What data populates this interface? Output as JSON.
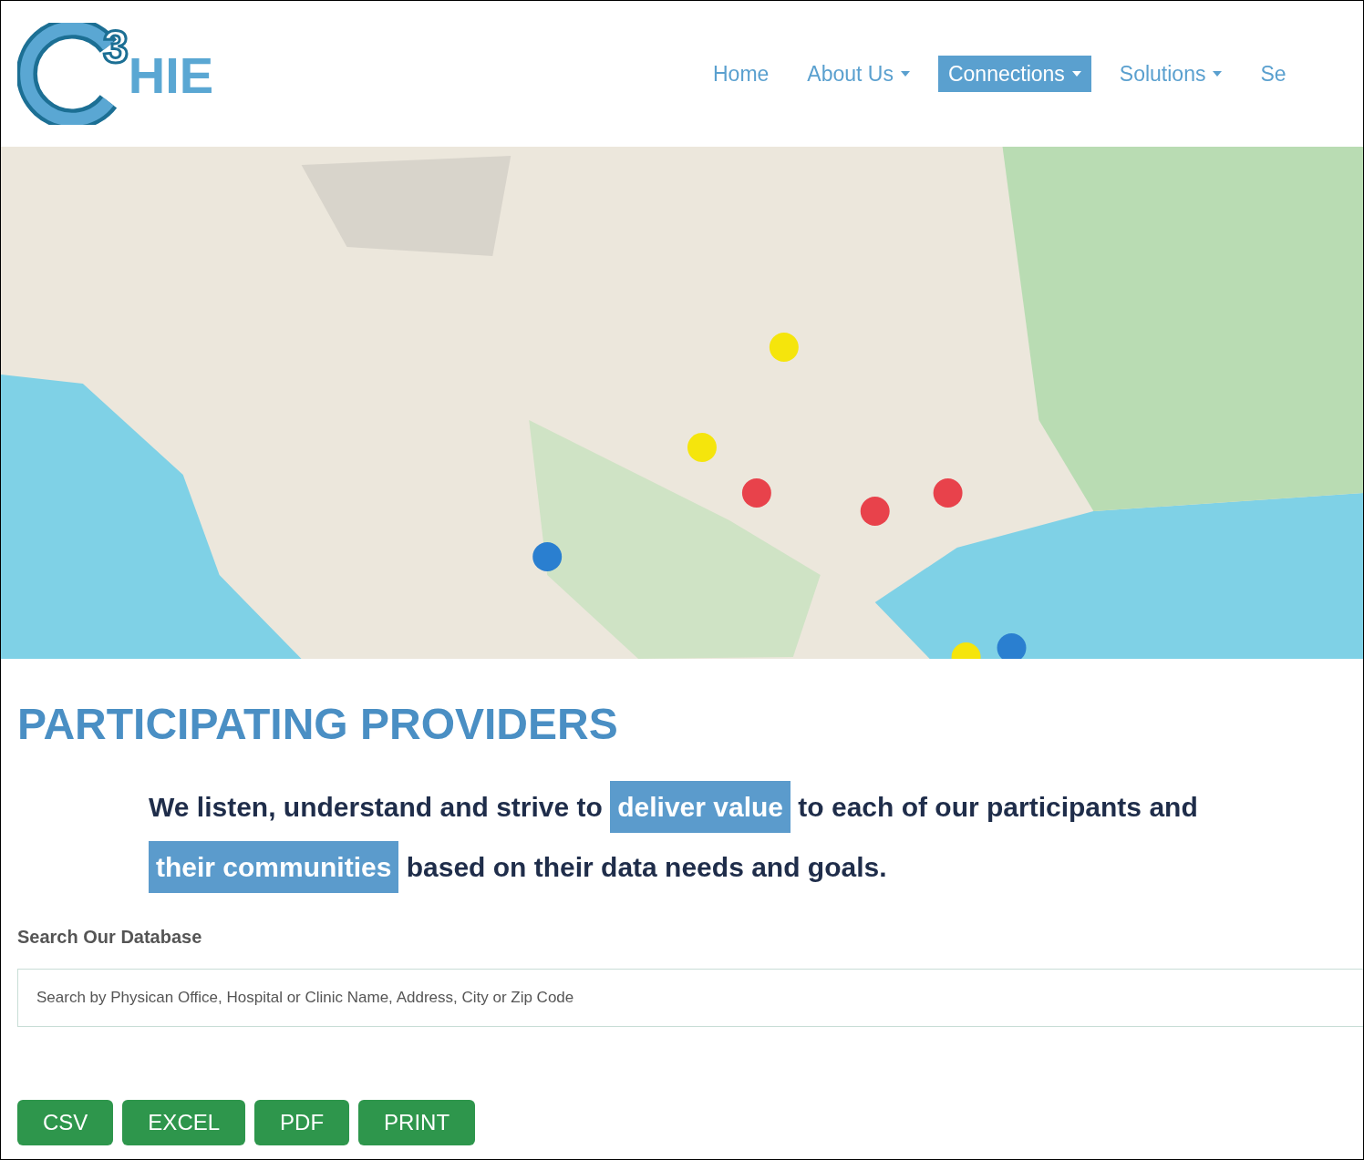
{
  "logo": {
    "superscript": "3",
    "wordmark": "HIE"
  },
  "nav": [
    {
      "label": "Home",
      "dropdown": false,
      "selected": false
    },
    {
      "label": "About Us",
      "dropdown": true,
      "selected": false
    },
    {
      "label": "Connections",
      "dropdown": true,
      "selected": true
    },
    {
      "label": "Solutions",
      "dropdown": true,
      "selected": false
    },
    {
      "label": "Se",
      "dropdown": false,
      "selected": false
    }
  ],
  "map": {
    "kind": "picture"
  },
  "heading": "PARTICIPATING PROVIDERS",
  "tagline": [
    {
      "text": "We listen, understand and strive to ",
      "highlight": false
    },
    {
      "text": "deliver value",
      "highlight": true
    },
    {
      "text": " to each of our participants and ",
      "highlight": false
    },
    {
      "text": "their communities",
      "highlight": true
    },
    {
      "text": " based on their data needs and goals.",
      "highlight": false
    }
  ],
  "search": {
    "label": "Search Our Database",
    "placeholder": "Search by Physican Office, Hospital or Clinic Name, Address, City or Zip Code"
  },
  "export_buttons": [
    "CSV",
    "EXCEL",
    "PDF",
    "PRINT"
  ]
}
